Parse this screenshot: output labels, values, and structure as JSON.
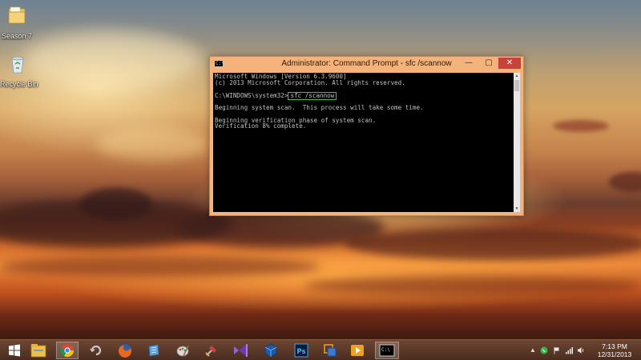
{
  "desktop": {
    "icons": [
      {
        "label": "Season 7",
        "icon": "folder-icon"
      },
      {
        "label": "Recycle Bin",
        "icon": "recycle-bin-icon"
      }
    ]
  },
  "cmd_window": {
    "title": "Administrator: Command Prompt - sfc  /scannow",
    "buttons": {
      "minimize": "—",
      "maximize": "▢",
      "close": "✕"
    },
    "console": {
      "line1": "Microsoft Windows [Version 6.3.9600]",
      "line2": "(c) 2013 Microsoft Corporation. All rights reserved.",
      "line3": "",
      "prompt": "C:\\WINDOWS\\system32>",
      "command": "sfc /scannow",
      "line5": "",
      "line6": "Beginning system scan.  This process will take some time.",
      "line7": "",
      "line8": "Beginning verification phase of system scan.",
      "line9": "Verification 8% complete."
    },
    "highlight_color": "#2ecc40"
  },
  "taskbar": {
    "apps": [
      "windows-start-icon",
      "file-explorer-icon",
      "chrome-icon",
      "loop-app-icon",
      "firefox-icon",
      "blue-app-icon",
      "paint-icon",
      "tools-icon",
      "visual-studio-icon",
      "virtualbox-icon",
      "photoshop-icon",
      "vmware-icon",
      "media-player-icon",
      "command-prompt-icon"
    ],
    "ps_label": "Ps",
    "cmd_label": "C:\\"
  },
  "tray": {
    "time": "7:13 PM",
    "date": "12/31/2013"
  }
}
